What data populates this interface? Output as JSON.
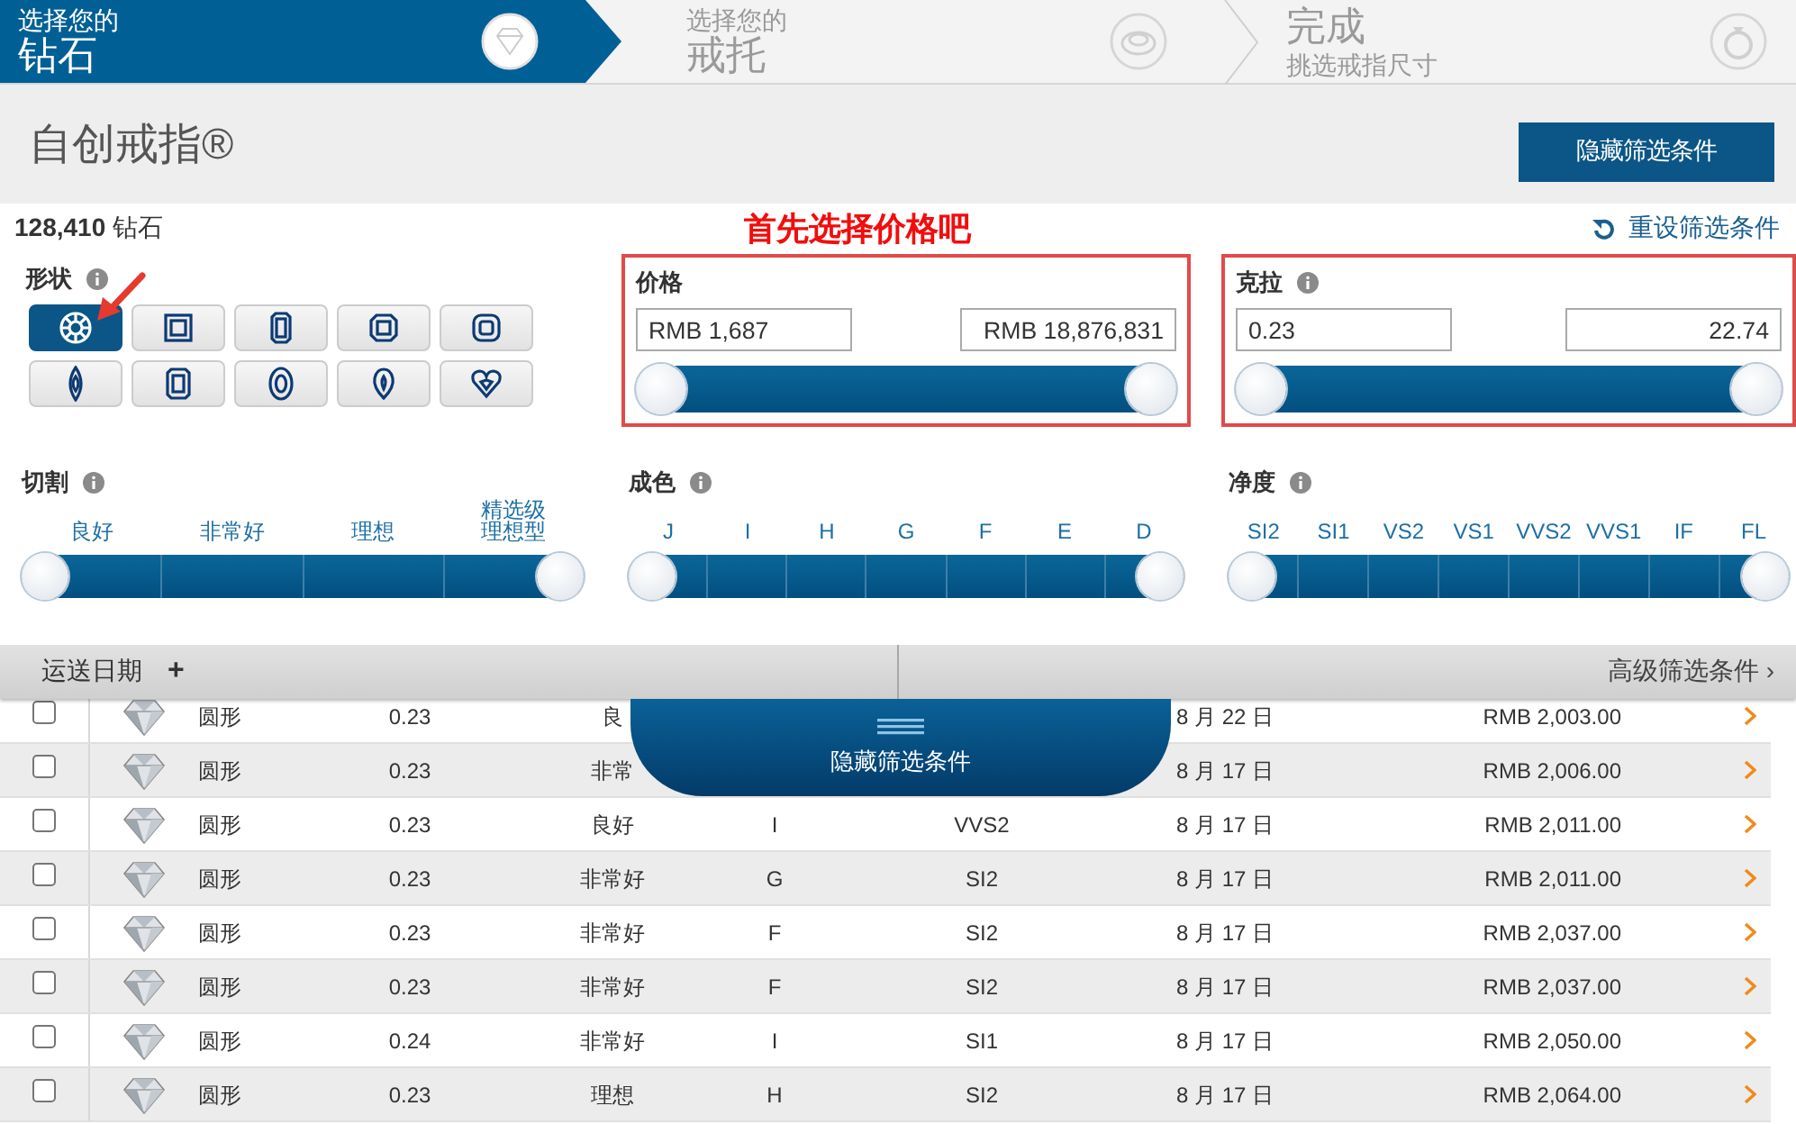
{
  "steps": [
    {
      "kind": "diamond",
      "caption": "选择您的",
      "title": "钻石",
      "caption_below": false,
      "selected": true
    },
    {
      "kind": "setting",
      "caption": "选择您的",
      "title": "戒托",
      "caption_below": false,
      "selected": false
    },
    {
      "kind": "ring",
      "title": "完成",
      "caption": "挑选戒指尺寸",
      "caption_below": true,
      "selected": false
    }
  ],
  "header": {
    "title": "自创戒指®",
    "button": "隐藏筛选条件"
  },
  "summary": {
    "count": "128,410",
    "count_label": "钻石",
    "hint": "首先选择价格吧",
    "reset": "重设筛选条件"
  },
  "shape": {
    "label": "形状",
    "info": true,
    "shapes": [
      {
        "kind": "round",
        "selected": true
      },
      {
        "kind": "princess",
        "selected": false
      },
      {
        "kind": "emerald",
        "selected": false
      },
      {
        "kind": "asscher",
        "selected": false
      },
      {
        "kind": "cushion",
        "selected": false
      },
      {
        "kind": "marquise",
        "selected": false
      },
      {
        "kind": "radiant",
        "selected": false
      },
      {
        "kind": "oval",
        "selected": false
      },
      {
        "kind": "pear",
        "selected": false
      },
      {
        "kind": "heart",
        "selected": false
      }
    ]
  },
  "price": {
    "label": "价格",
    "info": false,
    "highlighted": true,
    "min": "RMB 1,687",
    "max": "RMB 18,876,831",
    "thumbs": [
      {
        "level": 0
      },
      {
        "level": 1
      }
    ]
  },
  "carat": {
    "label": "克拉",
    "info": true,
    "highlighted": true,
    "min": "0.23",
    "max": "22.74",
    "thumbs": [
      {
        "level": 0
      },
      {
        "level": 1
      }
    ]
  },
  "cut": {
    "label": "切割",
    "info": true,
    "grades": [
      "良好",
      "非常好",
      "理想",
      "精选级理想型"
    ],
    "thumbs": [
      {
        "level": 0
      },
      {
        "level": 1
      }
    ]
  },
  "color": {
    "label": "成色",
    "info": true,
    "grades": [
      "J",
      "I",
      "H",
      "G",
      "F",
      "E",
      "D"
    ],
    "thumbs": [
      {
        "level": 0
      },
      {
        "level": 1
      }
    ]
  },
  "clarity": {
    "label": "净度",
    "info": true,
    "grades": [
      "SI2",
      "SI1",
      "VS2",
      "VS1",
      "VVS2",
      "VVS1",
      "IF",
      "FL"
    ],
    "thumbs": [
      {
        "level": 0
      },
      {
        "level": 1
      }
    ]
  },
  "bar": {
    "delivery": "运送日期",
    "add": "+",
    "advanced": "高级筛选条件",
    "advanced_arrow": "›"
  },
  "hide_tab": {
    "label": "隐藏筛选条件"
  },
  "rows": [
    {
      "checked": false,
      "shape": "圆形",
      "carat": "0.23",
      "cut": "良",
      "date": "8 月 22 日",
      "price": "RMB 2,003.00"
    },
    {
      "checked": false,
      "shape": "圆形",
      "carat": "0.23",
      "cut": "非常",
      "date": "8 月 17 日",
      "price": "RMB 2,006.00"
    },
    {
      "checked": false,
      "shape": "圆形",
      "carat": "0.23",
      "cut": "良好",
      "grade": "I",
      "clarity": "VVS2",
      "date": "8 月 17 日",
      "price": "RMB 2,011.00"
    },
    {
      "checked": false,
      "shape": "圆形",
      "carat": "0.23",
      "cut": "非常好",
      "grade": "G",
      "clarity": "SI2",
      "date": "8 月 17 日",
      "price": "RMB 2,011.00"
    },
    {
      "checked": false,
      "shape": "圆形",
      "carat": "0.23",
      "cut": "非常好",
      "grade": "F",
      "clarity": "SI2",
      "date": "8 月 17 日",
      "price": "RMB 2,037.00"
    },
    {
      "checked": false,
      "shape": "圆形",
      "carat": "0.23",
      "cut": "非常好",
      "grade": "F",
      "clarity": "SI2",
      "date": "8 月 17 日",
      "price": "RMB 2,037.00"
    },
    {
      "checked": false,
      "shape": "圆形",
      "carat": "0.24",
      "cut": "非常好",
      "grade": "I",
      "clarity": "SI1",
      "date": "8 月 17 日",
      "price": "RMB 2,050.00"
    },
    {
      "checked": false,
      "shape": "圆形",
      "carat": "0.23",
      "cut": "理想",
      "grade": "H",
      "clarity": "SI2",
      "date": "8 月 17 日",
      "price": "RMB 2,064.00"
    }
  ]
}
